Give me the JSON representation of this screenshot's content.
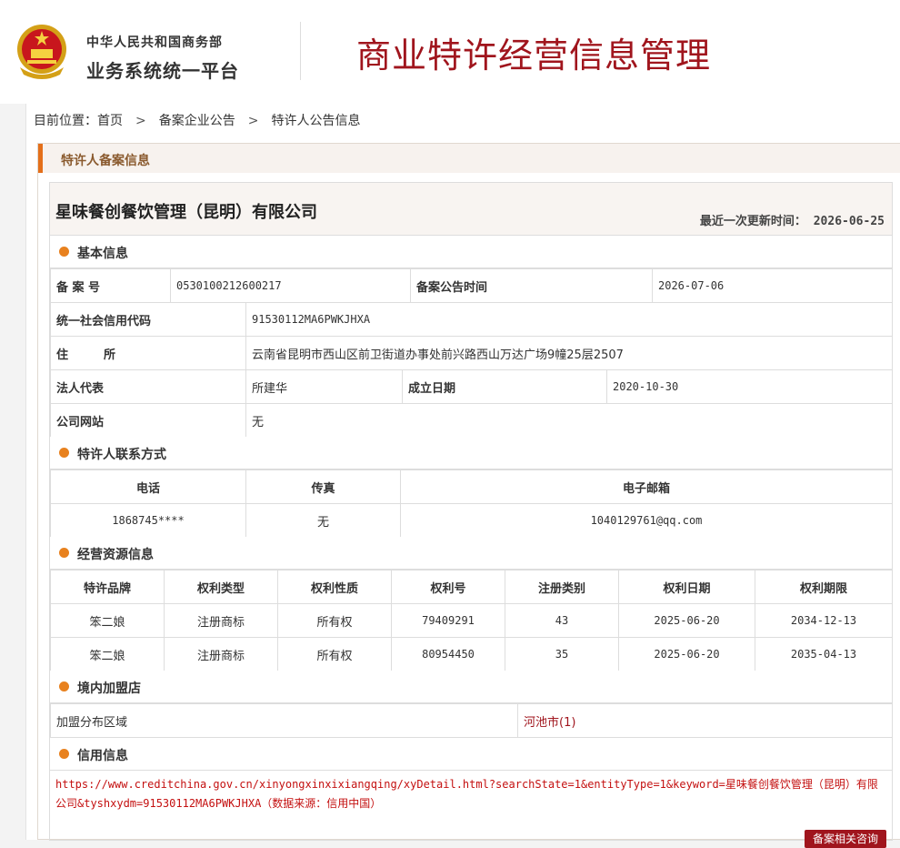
{
  "header": {
    "ministry": "中华人民共和国商务部",
    "platform": "业务系统统一平台",
    "system_title": "商业特许经营信息管理"
  },
  "breadcrumb": {
    "prefix": "目前位置：",
    "items": [
      "首页",
      "备案企业公告",
      "特许人公告信息"
    ]
  },
  "panel_title": "特许人备案信息",
  "company": {
    "name": "星味餐创餐饮管理（昆明）有限公司",
    "update_label": "最近一次更新时间：",
    "update_date": "2026-06-25"
  },
  "basic": {
    "section": "基本信息",
    "filing_no_label": "备 案 号",
    "filing_no": "0530100212600217",
    "filing_time_label": "备案公告时间",
    "filing_time": "2026-07-06",
    "credit_code_label": "统一社会信用代码",
    "credit_code": "91530112MA6PWKJHXA",
    "address_label": "住　　　所",
    "address": "云南省昆明市西山区前卫街道办事处前兴路西山万达广场9幢25层2507",
    "legal_rep_label": "法人代表",
    "legal_rep": "所建华",
    "established_label": "成立日期",
    "established": "2020-10-30",
    "website_label": "公司网站",
    "website": "无"
  },
  "contact": {
    "section": "特许人联系方式",
    "headers": [
      "电话",
      "传真",
      "电子邮箱"
    ],
    "phone": "1868745****",
    "fax": "无",
    "email": "1040129761@qq.com"
  },
  "resources": {
    "section": "经营资源信息",
    "headers": [
      "特许品牌",
      "权利类型",
      "权利性质",
      "权利号",
      "注册类别",
      "权利日期",
      "权利期限"
    ],
    "rows": [
      [
        "笨二娘",
        "注册商标",
        "所有权",
        "79409291",
        "43",
        "2025-06-20",
        "2034-12-13"
      ],
      [
        "笨二娘",
        "注册商标",
        "所有权",
        "80954450",
        "35",
        "2025-06-20",
        "2035-04-13"
      ]
    ]
  },
  "stores": {
    "section": "境内加盟店",
    "region_label": "加盟分布区域",
    "region_value": "河池市(1)"
  },
  "credit": {
    "section": "信用信息",
    "text": "https://www.creditchina.gov.cn/xinyongxinxixiangqing/xyDetail.html?searchState=1&entityType=1&keyword=星味餐创餐饮管理（昆明）有限公司&tyshxydm=91530112MA6PWKJHXA（数据来源：信用中国）"
  },
  "consult_button": "备案相关咨询",
  "colors": {
    "brand_red": "#a0151d",
    "accent_orange": "#e8811e"
  }
}
